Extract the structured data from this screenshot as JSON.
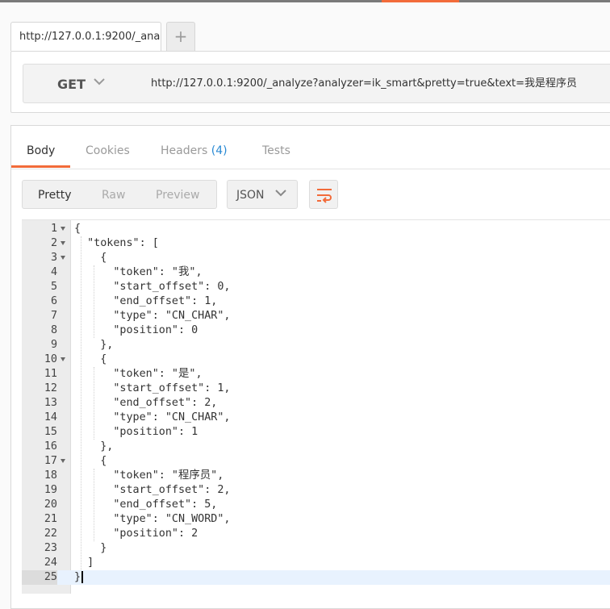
{
  "request_tab": {
    "title": "http://127.0.0.1:9200/_ana",
    "new_tab_icon": "plus-icon"
  },
  "request": {
    "method": "GET",
    "url": "http://127.0.0.1:9200/_analyze?analyzer=ik_smart&pretty=true&text=我是程序员"
  },
  "response_tabs": {
    "body": "Body",
    "cookies": "Cookies",
    "headers": "Headers",
    "headers_count": "(4)",
    "tests": "Tests"
  },
  "format": {
    "pretty": "Pretty",
    "raw": "Raw",
    "preview": "Preview",
    "language": "JSON",
    "wrap_icon": "wrap-lines-icon"
  },
  "code_lines": [
    "{",
    "  \"tokens\": [",
    "    {",
    "      \"token\": \"我\",",
    "      \"start_offset\": 0,",
    "      \"end_offset\": 1,",
    "      \"type\": \"CN_CHAR\",",
    "      \"position\": 0",
    "    },",
    "    {",
    "      \"token\": \"是\",",
    "      \"start_offset\": 1,",
    "      \"end_offset\": 2,",
    "      \"type\": \"CN_CHAR\",",
    "      \"position\": 1",
    "    },",
    "    {",
    "      \"token\": \"程序员\",",
    "      \"start_offset\": 2,",
    "      \"end_offset\": 5,",
    "      \"type\": \"CN_WORD\",",
    "      \"position\": 2",
    "    }",
    "  ]",
    "}"
  ],
  "foldable_lines": [
    1,
    2,
    3,
    10,
    17
  ],
  "active_line": 25,
  "colors": {
    "accent": "#f26b3a",
    "link": "#2a8ad4",
    "json_value": "#1a1aa6"
  }
}
